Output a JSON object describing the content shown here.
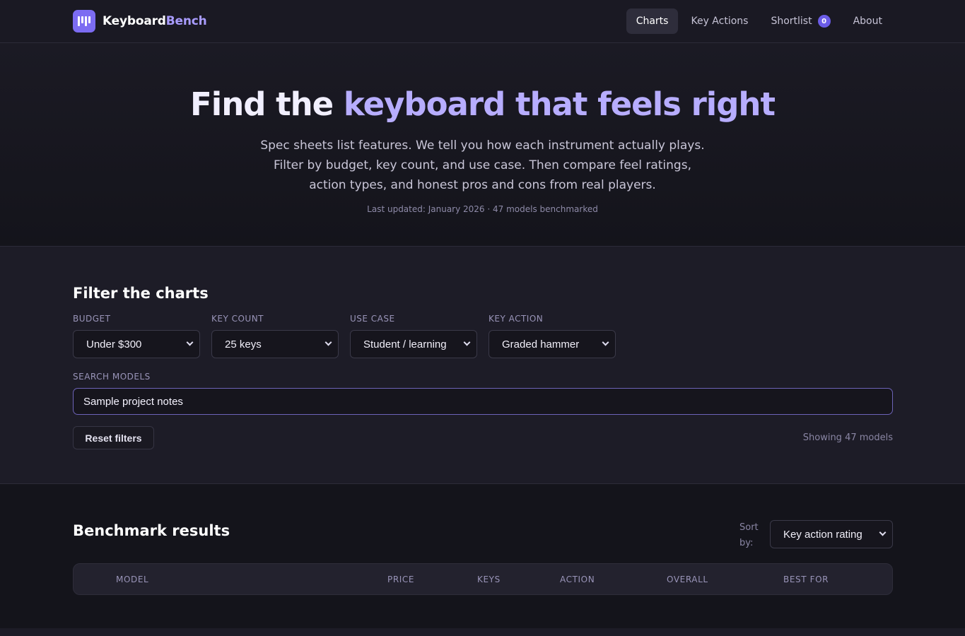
{
  "brand": {
    "name_part1": "Keyboard",
    "name_part2": "Bench",
    "logo_icon": "piano-keys-icon"
  },
  "nav": {
    "links": [
      "Charts",
      "Key Actions",
      "Shortlist",
      "About"
    ],
    "active": "Charts",
    "shortlist_count": "0"
  },
  "hero": {
    "title_part1": "Find the ",
    "title_part2": "keyboard that feels right",
    "subtitle": "Spec sheets list features. We tell you how each instrument actually plays. Filter by budget, key count, and use case. Then compare feel ratings, action types, and honest pros and cons from real players.",
    "meta": "Last updated: January 2026 · 47 models benchmarked"
  },
  "filters": {
    "title": "Filter the charts",
    "budget": {
      "label": "Budget",
      "value": "Under $300"
    },
    "key_count": {
      "label": "Key count",
      "value": "25 keys"
    },
    "use_case": {
      "label": "Use case",
      "value": "Student / learning"
    },
    "key_action": {
      "label": "Key action",
      "value": "Graded hammer"
    },
    "search": {
      "label": "Search models",
      "value": "Sample project notes"
    },
    "reset_label": "Reset filters",
    "showing": "Showing 47 models"
  },
  "results": {
    "title": "Benchmark results",
    "sort_label": "Sort by:",
    "sort_value": "Key action rating",
    "columns": [
      "Model",
      "Price",
      "Keys",
      "Action",
      "Overall",
      "Best for"
    ]
  },
  "colors": {
    "accent": "#7c6cf2",
    "accent_light": "#b7adff",
    "background": "#1a1923"
  }
}
